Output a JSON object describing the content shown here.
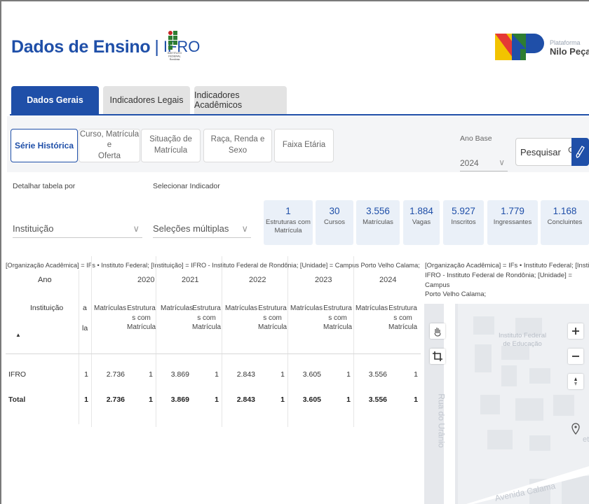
{
  "header": {
    "title": "Dados de Ensino",
    "separator": "|",
    "subtitle": "IFRO",
    "if_logo_text": "INSTITUTO FEDERAL Rondônia",
    "np_logo_small": "Plataforma",
    "np_logo_big": "Nilo Peçanha",
    "np_colors": [
      "#f2c300",
      "#2e7d32",
      "#1f4fa8"
    ]
  },
  "main_tabs": [
    {
      "label": "Dados Gerais",
      "active": true
    },
    {
      "label": "Indicadores Legais",
      "active": false
    },
    {
      "label": "Indicadores Acadêmicos",
      "active": false
    }
  ],
  "sub_tabs": [
    {
      "line1": "Série Histórica",
      "line2": "",
      "active": true
    },
    {
      "line1": "Curso, Matrícula e",
      "line2": "Oferta",
      "active": false
    },
    {
      "line1": "Situação de",
      "line2": "Matrícula",
      "active": false
    },
    {
      "line1": "Raça, Renda e Sexo",
      "line2": "",
      "active": false
    },
    {
      "line1": "Faixa Etária",
      "line2": "",
      "active": false
    }
  ],
  "ano_base": {
    "label": "Ano Base",
    "value": "2024"
  },
  "search": {
    "label": "Pesquisar"
  },
  "filters": {
    "detalhar_label": "Detalhar tabela por",
    "detalhar_value": "Instituição",
    "indicador_label": "Selecionar Indicador",
    "indicador_value": "Seleções múltiplas"
  },
  "kpis": [
    {
      "value": "1",
      "label1": "Estruturas com",
      "label2": "Matrícula"
    },
    {
      "value": "30",
      "label1": "Cursos",
      "label2": ""
    },
    {
      "value": "3.556",
      "label1": "Matrículas",
      "label2": ""
    },
    {
      "value": "1.884",
      "label1": "Vagas",
      "label2": ""
    },
    {
      "value": "5.927",
      "label1": "Inscritos",
      "label2": ""
    },
    {
      "value": "1.779",
      "label1": "Ingressantes",
      "label2": ""
    },
    {
      "value": "1.168",
      "label1": "Concluintes",
      "label2": ""
    }
  ],
  "table_filter_desc": "[Organização Acadêmica] = IFs • Instituto Federal; [Instituição] = IFRO - Instituto Federal de Rondônia; [Unidade] = Campus Porto Velho Calama;",
  "map_filter_desc": {
    "line1": "[Organização Acadêmica] = IFs • Instituto Federal; [Instituição] =",
    "line2": "IFRO - Instituto Federal de Rondônia; [Unidade] = Campus",
    "line3": "Porto Velho Calama;"
  },
  "table": {
    "corner_header": "Ano",
    "row_header": "Instituição",
    "sort_icon": "▲",
    "clipped_col_line1": "a",
    "clipped_col_line2": "la",
    "years": [
      "2020",
      "2021",
      "2022",
      "2023",
      "2024"
    ],
    "col_matriculas": "Matrículas",
    "col_estruturas": [
      "Estrutura",
      "s com",
      "Matrícula"
    ],
    "rows": [
      {
        "name": "IFRO",
        "first": "1",
        "values": [
          "2.736",
          "1",
          "3.869",
          "1",
          "2.843",
          "1",
          "3.605",
          "1",
          "3.556",
          "1"
        ]
      },
      {
        "name": "Total",
        "first": "1",
        "values": [
          "2.736",
          "1",
          "3.869",
          "1",
          "2.843",
          "1",
          "3.605",
          "1",
          "3.556",
          "1"
        ]
      }
    ]
  },
  "map": {
    "poi_line1": "Instituto Federal",
    "poi_line2": "de Educação",
    "street1": "Rua do Urânio",
    "street2": "Avenida Calama",
    "clipped_text": "et"
  }
}
